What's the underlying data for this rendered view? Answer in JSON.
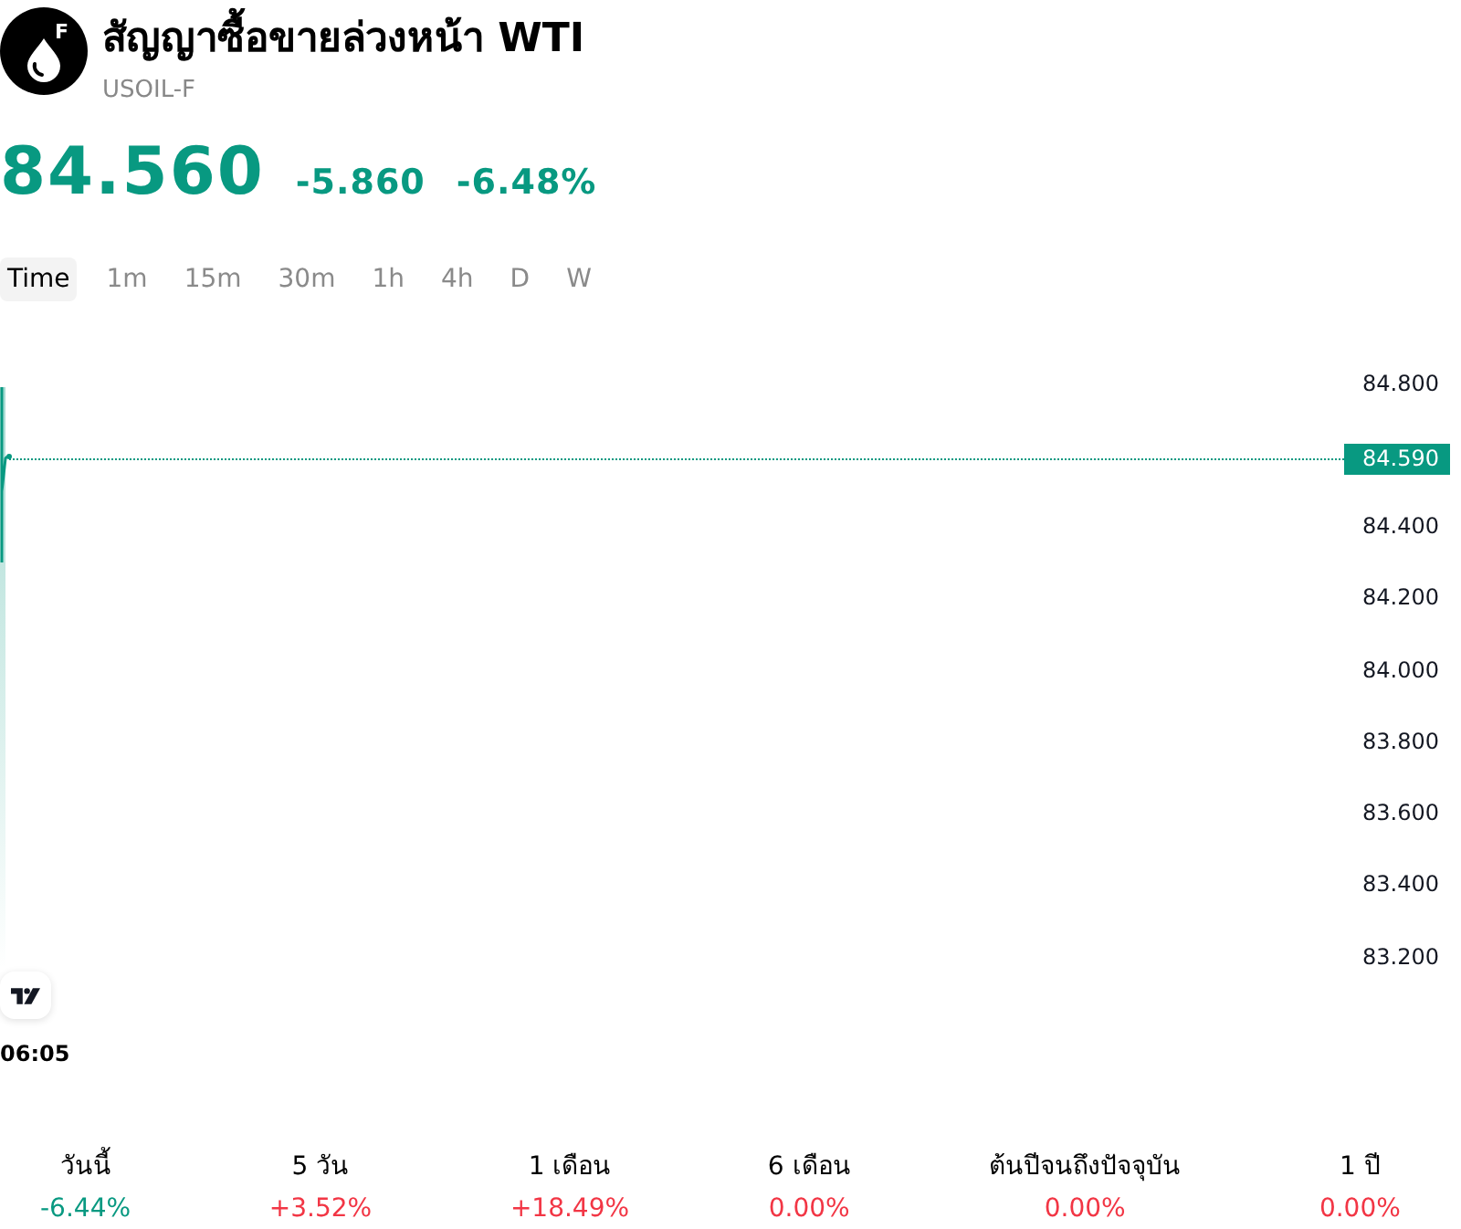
{
  "header": {
    "category_letter": "F",
    "title": "สัญญาซื้อขายล่วงหน้า WTI",
    "symbol": "USOIL-F",
    "price": "84.560",
    "change": "-5.860",
    "change_percent": "-6.48%"
  },
  "timeframes": [
    {
      "label": "Time",
      "selected": true
    },
    {
      "label": "1m",
      "selected": false
    },
    {
      "label": "15m",
      "selected": false
    },
    {
      "label": "30m",
      "selected": false
    },
    {
      "label": "1h",
      "selected": false
    },
    {
      "label": "4h",
      "selected": false
    },
    {
      "label": "D",
      "selected": false
    },
    {
      "label": "W",
      "selected": false
    }
  ],
  "chart": {
    "axis_labels": [
      {
        "kind": "tick",
        "text": "84.800"
      },
      {
        "kind": "current",
        "text": "84.590"
      },
      {
        "kind": "tick",
        "text": "84.400"
      },
      {
        "kind": "tick",
        "text": "84.200"
      },
      {
        "kind": "tick",
        "text": "84.000"
      },
      {
        "kind": "tick",
        "text": "83.800"
      },
      {
        "kind": "tick",
        "text": "83.600"
      },
      {
        "kind": "tick",
        "text": "83.400"
      },
      {
        "kind": "tick",
        "text": "83.200"
      }
    ],
    "time_label": "06:05"
  },
  "performance": [
    {
      "period": "วันนี้",
      "change": "-6.44%",
      "color": "#089981"
    },
    {
      "period": "5 วัน",
      "change": "+3.52%",
      "color": "#f23645"
    },
    {
      "period": "1 เดือน",
      "change": "+18.49%",
      "color": "#f23645"
    },
    {
      "period": "6 เดือน",
      "change": "0.00%",
      "color": "#f23645"
    },
    {
      "period": "ต้นปีจนถึงปัจจุบัน",
      "change": "0.00%",
      "color": "#f23645"
    },
    {
      "period": "1 ปี",
      "change": "0.00%",
      "color": "#f23645"
    }
  ]
}
